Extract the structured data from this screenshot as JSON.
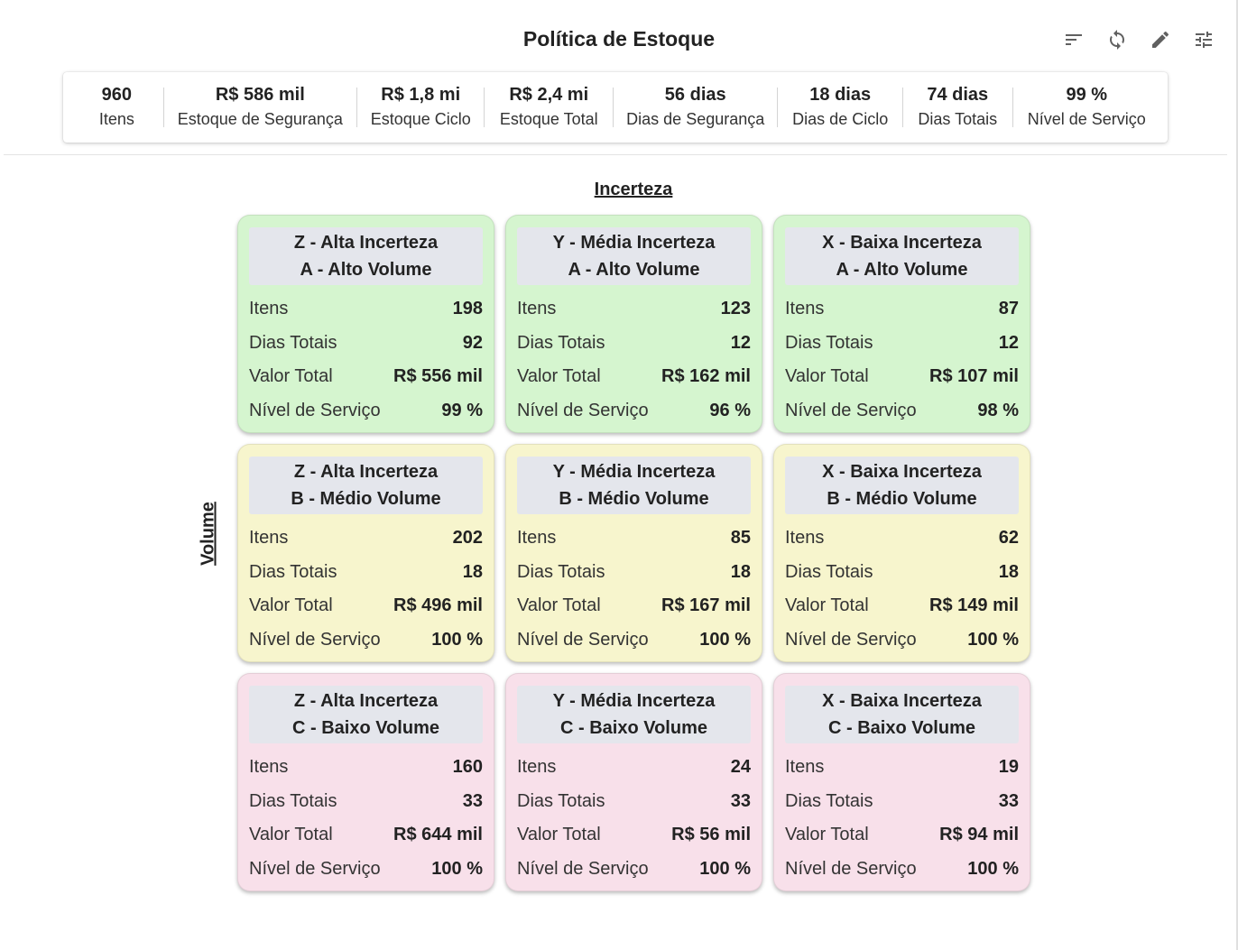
{
  "header": {
    "title": "Política de Estoque"
  },
  "toolbar": {
    "icons": [
      "sort-icon",
      "refresh-icon",
      "edit-icon",
      "tune-icon"
    ]
  },
  "summary": [
    {
      "value": "960",
      "label": "Itens"
    },
    {
      "value": "R$ 586 mil",
      "label": "Estoque de Segurança"
    },
    {
      "value": "R$ 1,8 mi",
      "label": "Estoque Ciclo"
    },
    {
      "value": "R$ 2,4 mi",
      "label": "Estoque Total"
    },
    {
      "value": "56 dias",
      "label": "Dias de Segurança"
    },
    {
      "value": "18 dias",
      "label": "Dias de Ciclo"
    },
    {
      "value": "74 dias",
      "label": "Dias Totais"
    },
    {
      "value": "99 %",
      "label": "Nível de Serviço"
    }
  ],
  "axes": {
    "top": "Incerteza",
    "left": "Volume"
  },
  "row_labels": {
    "itens": "Itens",
    "dias": "Dias Totais",
    "valor": "Valor Total",
    "nivel": "Nível de Serviço"
  },
  "colors": {
    "A": "#d5f5cf",
    "B": "#f7f5cd",
    "C": "#f8e0ea",
    "header": "#e4e6ec"
  },
  "matrix": [
    {
      "title1": "Z - Alta Incerteza",
      "title2": "A - Alto Volume",
      "itens": "198",
      "dias": "92",
      "valor": "R$ 556 mil",
      "nivel": "99 %"
    },
    {
      "title1": "Y - Média Incerteza",
      "title2": "A - Alto Volume",
      "itens": "123",
      "dias": "12",
      "valor": "R$ 162 mil",
      "nivel": "96 %"
    },
    {
      "title1": "X - Baixa Incerteza",
      "title2": "A - Alto Volume",
      "itens": "87",
      "dias": "12",
      "valor": "R$ 107 mil",
      "nivel": "98 %"
    },
    {
      "title1": "Z - Alta Incerteza",
      "title2": "B - Médio Volume",
      "itens": "202",
      "dias": "18",
      "valor": "R$ 496 mil",
      "nivel": "100 %"
    },
    {
      "title1": "Y - Média Incerteza",
      "title2": "B - Médio Volume",
      "itens": "85",
      "dias": "18",
      "valor": "R$ 167 mil",
      "nivel": "100 %"
    },
    {
      "title1": "X - Baixa Incerteza",
      "title2": "B - Médio Volume",
      "itens": "62",
      "dias": "18",
      "valor": "R$ 149 mil",
      "nivel": "100 %"
    },
    {
      "title1": "Z - Alta Incerteza",
      "title2": "C - Baixo Volume",
      "itens": "160",
      "dias": "33",
      "valor": "R$ 644 mil",
      "nivel": "100 %"
    },
    {
      "title1": "Y - Média Incerteza",
      "title2": "C - Baixo Volume",
      "itens": "24",
      "dias": "33",
      "valor": "R$ 56 mil",
      "nivel": "100 %"
    },
    {
      "title1": "X - Baixa Incerteza",
      "title2": "C - Baixo Volume",
      "itens": "19",
      "dias": "33",
      "valor": "R$ 94 mil",
      "nivel": "100 %"
    }
  ]
}
